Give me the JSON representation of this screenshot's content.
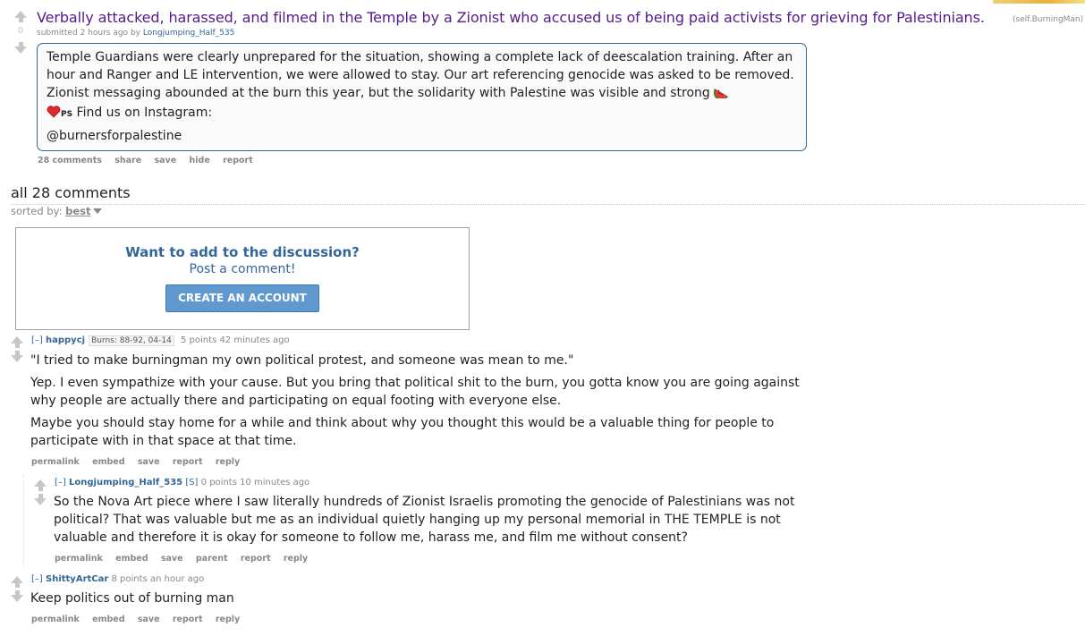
{
  "post": {
    "score": "0",
    "title": "Verbally attacked, harassed, and filmed in the Temple by a Zionist who accused us of being paid activists for grieving for Palestinians.",
    "domain": "(self.BurningMan)",
    "submitted_prefix": "submitted",
    "time": "2 hours ago",
    "by": "by",
    "author": "Longjumping_Half_535",
    "selftext": {
      "para1_a": "Temple Guardians were clearly unprepared for the situation, showing a complete lack of deescalation training. After an hour and Ranger and LE intervention, we were allowed to stay. Our art referencing genocide was asked to be removed. Zionist messaging abounded at the burn this year, but the solidarity with Palestine was visible and strong ",
      "ps_label": "PS",
      "para1_b": " Find us on Instagram:",
      "para2": "@burnersforpalestine"
    },
    "buttons": {
      "comments": "28 comments",
      "share": "share",
      "save": "save",
      "hide": "hide",
      "report": "report"
    }
  },
  "comments_area": {
    "heading": "all 28 comments",
    "sorted_label": "sorted by:",
    "sort_value": "best"
  },
  "cta": {
    "heading": "Want to add to the discussion?",
    "sub": "Post a comment!",
    "button": "CREATE AN ACCOUNT"
  },
  "comments": [
    {
      "expand": "[–]",
      "author": "happycj",
      "flair": "Burns: 88-92, 04-14",
      "points": "5 points",
      "time": "42 minutes ago",
      "paragraphs": [
        "\"I tried to make burningman my own political protest, and someone was mean to me.\"",
        "Yep. I even sympathize with your cause. But you bring that political shit to the burn, you gotta know you are going against why people are actually there and participating on equal footing with everyone else.",
        "Maybe you should stay home for a while and think about why you thought this would be a valuable thing for people to participate with in that space at that time."
      ],
      "buttons": {
        "permalink": "permalink",
        "embed": "embed",
        "save": "save",
        "report": "report",
        "reply": "reply"
      }
    },
    {
      "expand": "[–]",
      "author": "Longjumping_Half_535",
      "submitter": "[S]",
      "points": "0 points",
      "time": "10 minutes ago",
      "paragraphs": [
        "So the Nova Art piece where I saw literally hundreds of Zionist Israelis promoting the genocide of Palestinians was not political? That was valuable but me as an individual quietly hanging up my personal memorial in THE TEMPLE is not valuable and therefore it is okay for someone to follow me, harass me, and film me without consent?"
      ],
      "buttons": {
        "permalink": "permalink",
        "embed": "embed",
        "save": "save",
        "parent": "parent",
        "report": "report",
        "reply": "reply"
      }
    },
    {
      "expand": "[–]",
      "author": "ShittyArtCar",
      "points": "8 points",
      "time": "an hour ago",
      "paragraphs": [
        "Keep politics out of burning man"
      ],
      "buttons": {
        "permalink": "permalink",
        "embed": "embed",
        "save": "save",
        "report": "report",
        "reply": "reply"
      }
    }
  ]
}
